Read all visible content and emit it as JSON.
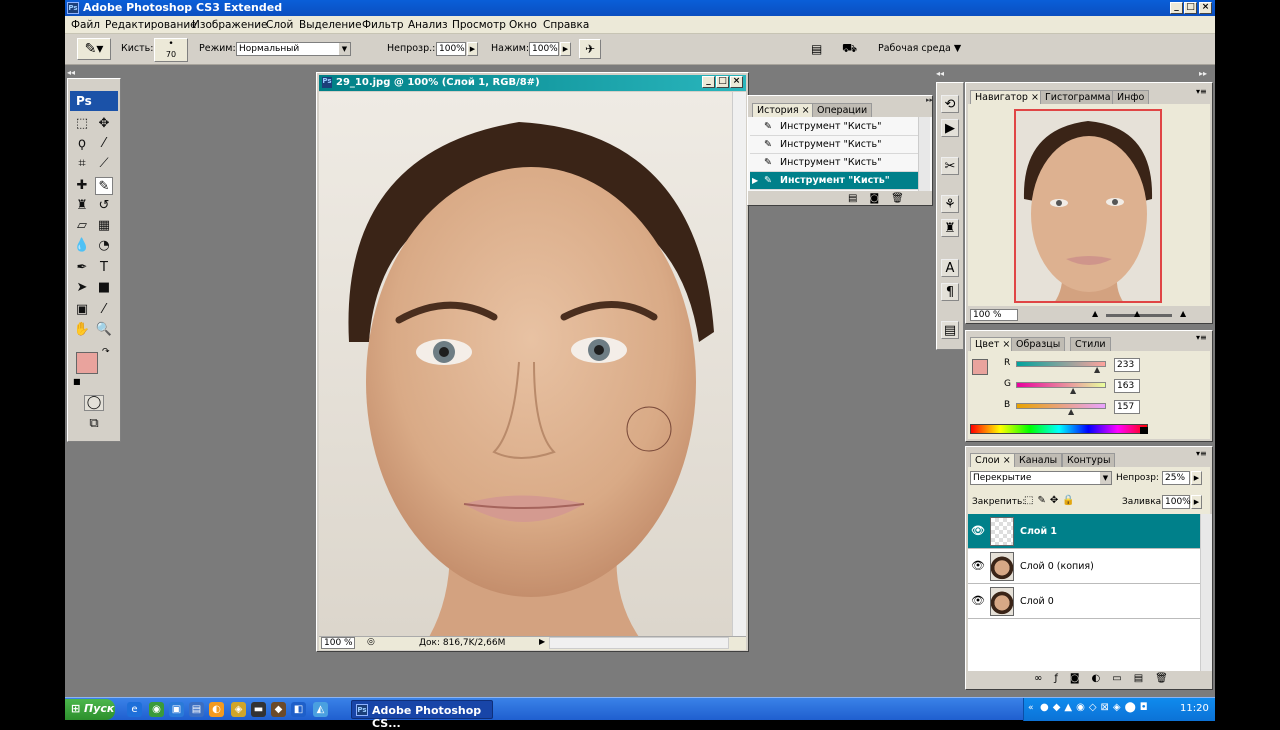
{
  "app": {
    "title": "Adobe Photoshop CS3 Extended",
    "ps_logo": "Ps"
  },
  "menu": [
    "Файл",
    "Редактирование",
    "Изображение",
    "Слой",
    "Выделение",
    "Фильтр",
    "Анализ",
    "Просмотр",
    "Окно",
    "Справка"
  ],
  "options": {
    "brush_label": "Кисть:",
    "brush_size": "70",
    "mode_label": "Режим:",
    "mode_value": "Нормальный",
    "opacity_label": "Непрозр.:",
    "opacity_value": "100%",
    "flow_label": "Нажим:",
    "flow_value": "100%",
    "workspace_label": "Рабочая среда"
  },
  "document": {
    "title": "29_10.jpg @ 100% (Слой 1, RGB/8#)",
    "zoom": "100 %",
    "doc_info": "Док: 816,7K/2,66M"
  },
  "history": {
    "tabs": [
      "История",
      "Операции"
    ],
    "items": [
      "Инструмент \"Кисть\"",
      "Инструмент \"Кисть\"",
      "Инструмент \"Кисть\"",
      "Инструмент \"Кисть\""
    ],
    "selected_index": 3
  },
  "navigator": {
    "tabs": [
      "Навигатор",
      "Гистограмма",
      "Инфо"
    ],
    "zoom": "100 %"
  },
  "color_panel": {
    "tabs": [
      "Цвет",
      "Образцы",
      "Стили"
    ],
    "channels": [
      {
        "label": "R",
        "value": "233"
      },
      {
        "label": "G",
        "value": "163"
      },
      {
        "label": "B",
        "value": "157"
      }
    ],
    "foreground": "#e9a39d",
    "background": "#ffffff"
  },
  "layers": {
    "tabs": [
      "Слои",
      "Каналы",
      "Контуры"
    ],
    "blend_mode": "Перекрытие",
    "opacity_label": "Непрозр:",
    "opacity_value": "25%",
    "lock_label": "Закрепить:",
    "fill_label": "Заливка:",
    "fill_value": "100%",
    "items": [
      {
        "name": "Слой 1",
        "selected": true
      },
      {
        "name": "Слой 0 (копия)",
        "selected": false
      },
      {
        "name": "Слой 0",
        "selected": false
      }
    ]
  },
  "taskbar": {
    "start": "Пуск",
    "active_item": "Adobe Photoshop CS...",
    "clock": "11:20"
  },
  "colors": {
    "title_bar": "#0b4fc0",
    "doc_title": "#007f86",
    "selection": "#00808a"
  }
}
